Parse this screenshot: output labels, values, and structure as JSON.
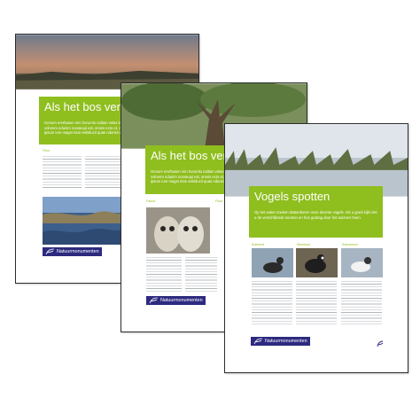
{
  "pages": [
    {
      "title": "Als het bos verdw",
      "intro": "Genum ererbusen nim horumlu nallam velus lamnia elit iure dolo ma ut oculis etum vellis volorem ndunim nonsequi est, omnis ecto et, olla nemo ne sin. Ibusas ac ere nuvellibas ex ipsum iure magni ntus velisilucit quas ndunim reperitur excepe.",
      "column_labels": [
        "Fleur",
        "Fauna"
      ],
      "logo_text": "Natuurmonumenten"
    },
    {
      "title": "Als het bos verdw",
      "intro": "Genum ererbusen nim horumlu nallam velus lamnia elit iure dolo ma ut oculis etum vellis volorem ndunim nonsequi est, omnis ecto et, olla nemo ne sin. Ibusas ac ere nuvellibas ex ipsum iure magni ntus velisilucit quas ndunim reperitur excepe.",
      "column_labels": [
        "Fauna",
        "Flora"
      ],
      "logo_text": "Natuurmonumenten"
    },
    {
      "title": "Vogels spotten",
      "intro": "Op het water zoeken Waterdieren onze diverse vogels. Als u goed kijkt ziet u de verschillende soorten en hun gedrag door het seizoen heen.",
      "column_labels": [
        "Kuifeend",
        "Meerkoet",
        "Kokmeeuw"
      ],
      "logo_text": "Natuurmonumenten"
    }
  ],
  "colors": {
    "accent_green": "#8fbe1f",
    "logo_navy": "#2d2a7f",
    "page_border": "#2b2b2b"
  },
  "icons": [
    "natuurmonumenten-logo-icon",
    "nature-photo",
    "owl-photo",
    "bird-photo"
  ]
}
